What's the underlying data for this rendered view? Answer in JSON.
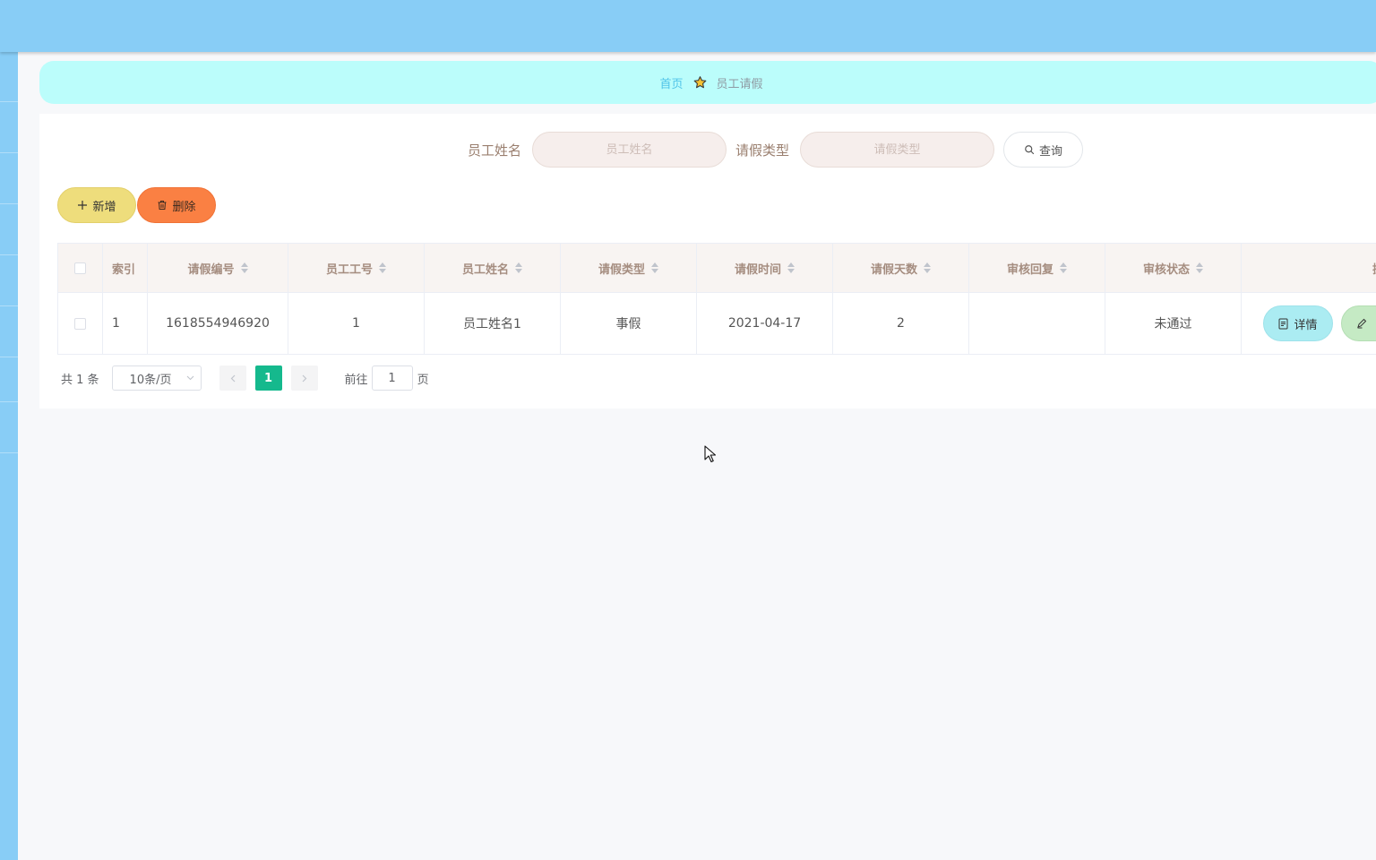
{
  "breadcrumb": {
    "home": "首页",
    "current": "员工请假"
  },
  "search": {
    "name_label": "员工姓名",
    "name_placeholder": "员工姓名",
    "type_label": "请假类型",
    "type_placeholder": "请假类型",
    "query_label": "查询"
  },
  "toolbar": {
    "add_label": "新增",
    "delete_label": "删除"
  },
  "table": {
    "headers": [
      "索引",
      "请假编号",
      "员工工号",
      "员工姓名",
      "请假类型",
      "请假时间",
      "请假天数",
      "审核回复",
      "审核状态",
      "操"
    ],
    "rows": [
      {
        "index": "1",
        "leave_no": "1618554946920",
        "emp_no": "1",
        "emp_name": "员工姓名1",
        "leave_type": "事假",
        "leave_date": "2021-04-17",
        "leave_days": "2",
        "review_reply": "",
        "review_status": "未通过",
        "detail_label": "详情"
      }
    ]
  },
  "pagination": {
    "total_text": "共 1 条",
    "page_size": "10条/页",
    "current_page": "1",
    "goto_label": "前往",
    "goto_value": "1",
    "page_suffix": "页"
  },
  "colors": {
    "topbar": "#88cdf6",
    "breadcrumb_bg": "#bbfdfb",
    "add_button": "#eedd7c",
    "delete_button": "#fa8043",
    "detail_button": "#abecf2",
    "edit_button": "#c5eac4",
    "active_page": "#15b98d"
  }
}
